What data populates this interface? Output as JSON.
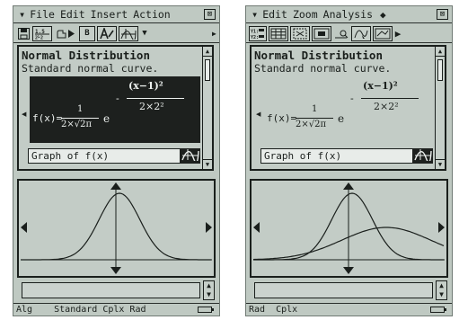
{
  "left": {
    "menu": {
      "chevron": "▾",
      "items": [
        "File",
        "Edit",
        "Insert",
        "Action"
      ],
      "close": "⊠"
    },
    "toolbar": {
      "bold_label": "B",
      "more": "▸"
    },
    "doc": {
      "title": "Normal Distribution",
      "subtitle": "Standard normal curve.",
      "formula_lhs": "f(x)=",
      "frac_num": "1",
      "frac_den": "2×√2π",
      "base": "e",
      "exp_minus": "-",
      "exp_num": "(x−1)²",
      "exp_den": "2×2²",
      "graph_row": "Graph of f(x)"
    },
    "status": "Alg    Standard Cplx Rad"
  },
  "right": {
    "menu": {
      "chevron": "▾",
      "items": [
        "Edit",
        "Zoom",
        "Analysis"
      ],
      "diamond": "◆",
      "close": "⊠"
    },
    "doc": {
      "title": "Normal Distribution",
      "subtitle": "Standard normal curve.",
      "formula_lhs": "f(x)=",
      "frac_num": "1",
      "frac_den": "2×√2π",
      "base": "e",
      "exp_minus": "-",
      "exp_num": "(x−1)²",
      "exp_den": "2×2²",
      "graph_row": "Graph of f(x)"
    },
    "status": "Rad  Cplx"
  },
  "colors": {
    "screen": "#bfc9c2",
    "ink": "#1a1f1c",
    "highlight": "#1d201e"
  },
  "icons": [
    "chevron-down-icon",
    "close-icon",
    "save-icon",
    "graph-icon",
    "scroll-up-icon",
    "scroll-down-icon",
    "battery-icon"
  ]
}
